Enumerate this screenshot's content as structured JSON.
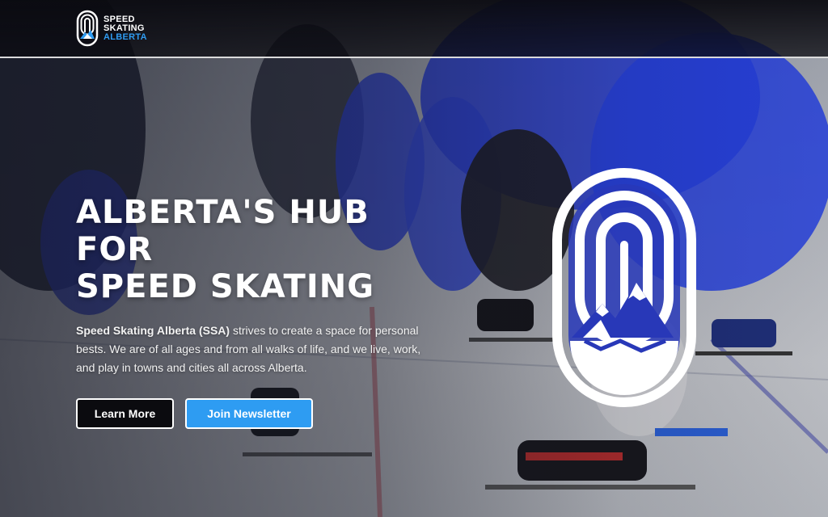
{
  "brand": {
    "logo_lines": [
      "SPEED",
      "SKATING",
      "ALBERTA"
    ],
    "accent_color": "#2e9cf2",
    "logo_icon": "ssa-emblem-icon"
  },
  "hero": {
    "title_line1": "ALBERTA'S HUB FOR",
    "title_line2": "SPEED SKATING",
    "description_strong": "Speed Skating Alberta (SSA)",
    "description_rest": " strives to create a space for personal bests. We are of all ages and from all walks of life, and we live, work, and play in towns and cities all across Alberta.",
    "primary_button": "Learn More",
    "secondary_button": "Join Newsletter",
    "emblem_icon": "ssa-emblem-icon",
    "background_image": "speed-skaters-on-ice-photo"
  },
  "colors": {
    "header_bg": "#0a0a10",
    "button_dark": "#0b0b0f",
    "button_blue": "#2e9cf2",
    "skater_blue": "#2a3fd1"
  }
}
